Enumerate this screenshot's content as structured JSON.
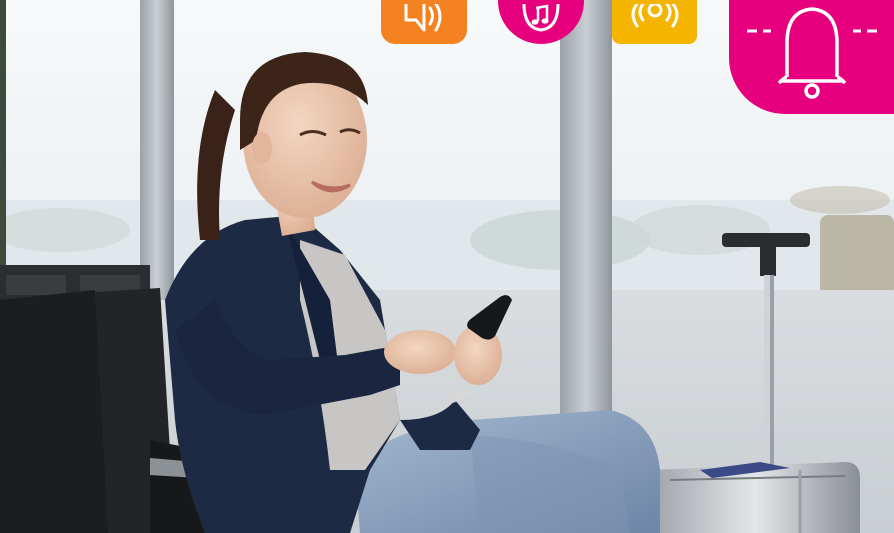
{
  "photo": {
    "subject": "woman-using-smartphone-in-airport-lounge"
  },
  "icon_badges": [
    {
      "icon": "speaker-icon",
      "color": "#f58220"
    },
    {
      "icon": "music-note-icon",
      "color": "#e6007e"
    },
    {
      "icon": "vibrate-icon",
      "color": "#f5b400"
    }
  ],
  "alert_badge": {
    "icon": "bell-icon",
    "color": "#e6007e"
  },
  "colors": {
    "window_light": "#f4f6f7",
    "frame_gray": "#b7bdc2",
    "seat_black": "#1c1d20",
    "blazer_navy": "#1d2a44",
    "jeans_blue": "#8fa6c2",
    "suitcase_silver": "#c7cbd0"
  }
}
